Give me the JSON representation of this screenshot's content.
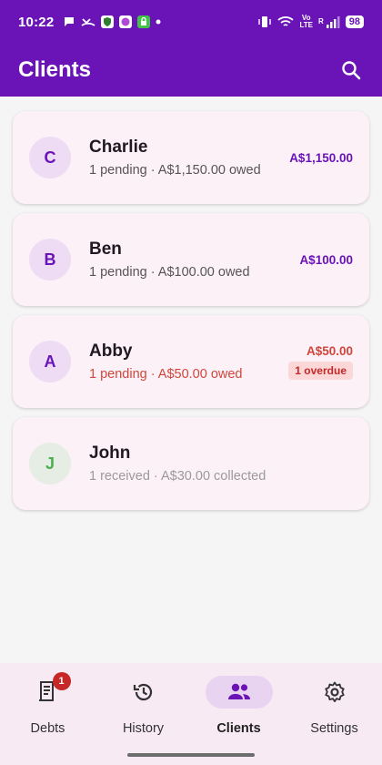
{
  "status_bar": {
    "time": "10:22",
    "battery": "98",
    "network_label_top": "Vo",
    "network_label_bottom": "LTE",
    "roaming_label": "R"
  },
  "app_bar": {
    "title": "Clients",
    "search_icon": "search-icon"
  },
  "clients": [
    {
      "initial": "C",
      "name": "Charlie",
      "summary": "1 pending · A$1,150.00 owed",
      "amount": "A$1,150.00",
      "badge": ""
    },
    {
      "initial": "B",
      "name": "Ben",
      "summary": "1 pending · A$100.00 owed",
      "amount": "A$100.00",
      "badge": ""
    },
    {
      "initial": "A",
      "name": "Abby",
      "summary": "1 pending · A$50.00 owed",
      "amount": "A$50.00",
      "badge": "1 overdue"
    },
    {
      "initial": "J",
      "name": "John",
      "summary": "1 received · A$30.00 collected",
      "amount": "",
      "badge": ""
    }
  ],
  "bottom_nav": {
    "items": [
      {
        "label": "Debts",
        "icon": "receipt-icon",
        "badge": "1"
      },
      {
        "label": "History",
        "icon": "history-icon"
      },
      {
        "label": "Clients",
        "icon": "people-icon",
        "active": true
      },
      {
        "label": "Settings",
        "icon": "gear-icon"
      }
    ]
  },
  "colors": {
    "primary": "#6a14b8",
    "card_bg": "#fcf1f7",
    "danger": "#d0463b",
    "success": "#4caf50"
  }
}
